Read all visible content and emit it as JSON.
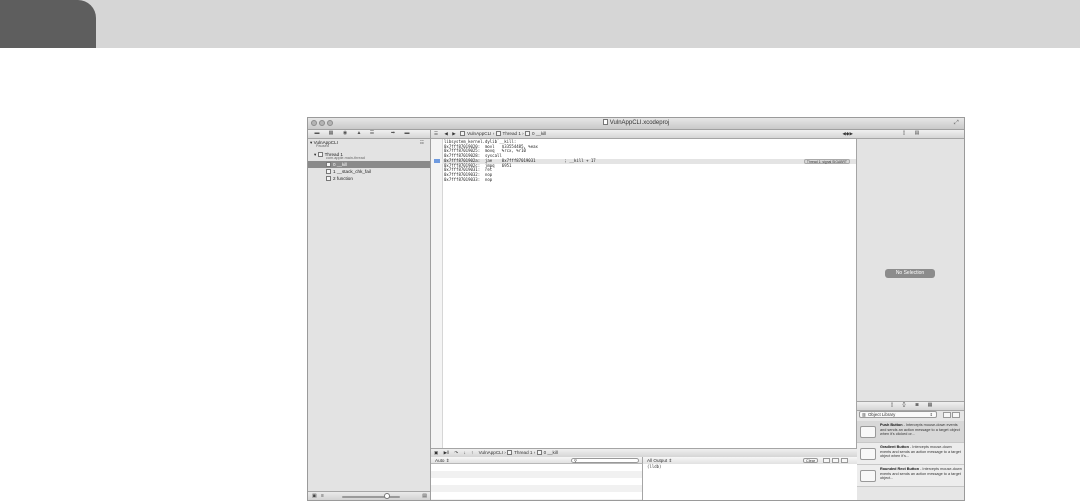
{
  "window": {
    "title": "VulnAppCLI.xcodeproj",
    "fullscreen_glyph": "⤢"
  },
  "navigator": {
    "toolbar_icons": [
      "folder-icon",
      "symbol-icon",
      "search-icon",
      "warning-icon",
      "debug-icon",
      "breakpoint-icon",
      "log-icon"
    ],
    "process_name": "VulnAppCLI",
    "process_status": "Paused",
    "thread_name": "Thread 1",
    "thread_queue": "com.apple.main-thread",
    "frames": [
      {
        "label": "0 __kill"
      },
      {
        "label": "1 __stack_chk_fail"
      },
      {
        "label": "2 function"
      }
    ]
  },
  "jumpbar": {
    "crumbs": [
      "VulnAppCLI",
      "Thread 1",
      "0 __kill"
    ]
  },
  "editor": {
    "lines": [
      "libsystem_kernel.dylib`__kill:",
      "0x7fff87019020:  movl   $33554485, %eax",
      "0x7fff87019025:  movq   %rcx, %r10",
      "0x7fff87019028:  syscall",
      "0x7fff8701902a:  jae    0x7fff87019031            ; __kill + 17",
      "0x7fff8701902c:  jmpq   6951",
      "0x7fff87019031:  ret",
      "0x7fff87019032:  nop",
      "0x7fff87019033:  nop"
    ],
    "highlight_line_index": 4,
    "thread_badge": "Thread 1: signal SIGABRT"
  },
  "debugbar": {
    "crumbs": [
      "VulnAppCLI",
      "Thread 1",
      "0 __kill"
    ]
  },
  "variables": {
    "scope": "Auto ⇕",
    "search_placeholder": ""
  },
  "console": {
    "mode": "All Output ⇕",
    "clear_label": "Clear",
    "prompt": "(lldb)"
  },
  "utilities": {
    "no_selection": "No Selection",
    "library_name": "Object Library",
    "library_items": [
      {
        "title": "Push Button",
        "desc": " - Intercepts mouse-down events and sends an action message to a target object when it's clicked or..."
      },
      {
        "title": "Gradient Button",
        "desc": " - Intercepts mouse-down events and sends an action message to a target object when it's..."
      },
      {
        "title": "Rounded Rect Button",
        "desc": " - Intercepts mouse-down events and sends an action message to a target object..."
      }
    ]
  }
}
